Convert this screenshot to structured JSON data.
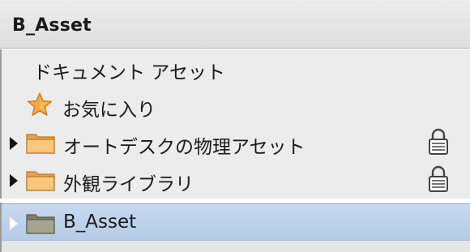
{
  "header": {
    "title": "B_Asset"
  },
  "tree": {
    "items": [
      {
        "label": "ドキュメント アセット",
        "icon": "none"
      },
      {
        "label": "お気に入り",
        "icon": "star-icon"
      },
      {
        "label": "オートデスクの物理アセット",
        "icon": "folder-icon",
        "locked": true
      },
      {
        "label": "外観ライブラリ",
        "icon": "folder-icon",
        "locked": true
      }
    ],
    "selected": {
      "label": "B_Asset",
      "icon": "folder-icon"
    }
  },
  "colors": {
    "folder": "#f2b45a",
    "star": "#f39a2b",
    "selection": "#b9cde8",
    "selected_folder": "#9a9a85"
  }
}
